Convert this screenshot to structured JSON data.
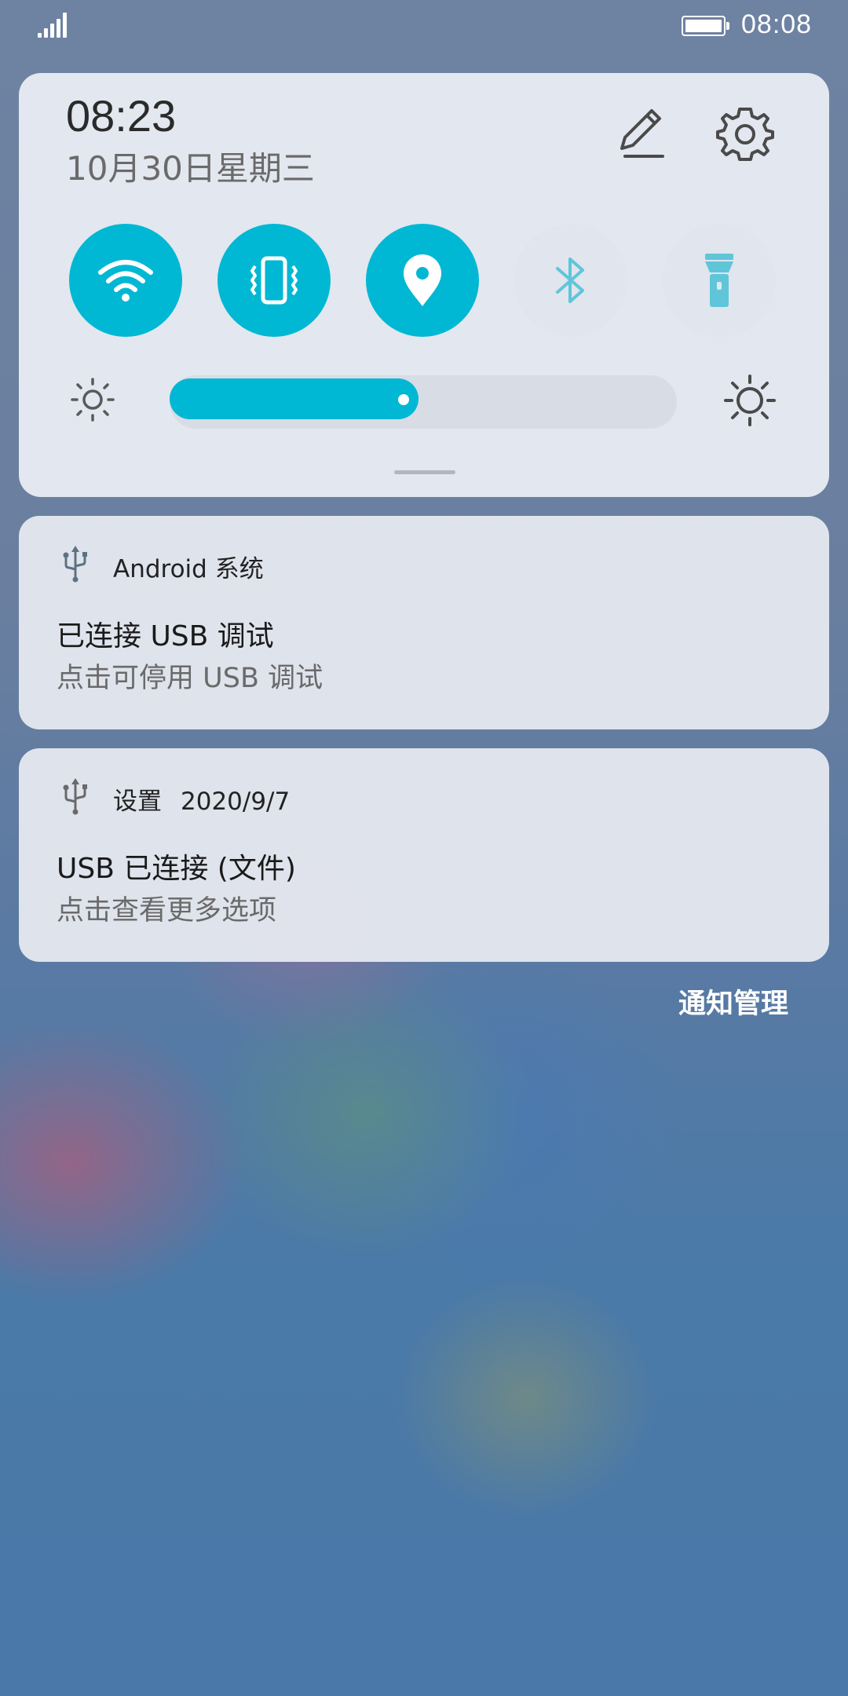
{
  "status_bar": {
    "time": "08:08",
    "signal_icon": "signal-strength-icon",
    "battery_icon": "battery-icon"
  },
  "quick_settings": {
    "time": "08:23",
    "date": "10月30日星期三",
    "edit_icon": "pencil-icon",
    "settings_icon": "gear-icon",
    "accent_color": "#00b8d4",
    "tiles": [
      {
        "icon": "wifi-icon",
        "state": "on"
      },
      {
        "icon": "vibrate-icon",
        "state": "on"
      },
      {
        "icon": "location-icon",
        "state": "on"
      },
      {
        "icon": "bluetooth-icon",
        "state": "off"
      },
      {
        "icon": "flashlight-icon",
        "state": "off"
      }
    ],
    "brightness": {
      "level": 0.49,
      "low_icon": "brightness-low-icon",
      "high_icon": "brightness-high-icon"
    }
  },
  "notifications": [
    {
      "icon": "usb-icon",
      "app": "Android 系统",
      "date": "",
      "title": "已连接 USB 调试",
      "body": "点击可停用 USB 调试"
    },
    {
      "icon": "usb-icon",
      "app": "设置",
      "date": "2020/9/7",
      "title": "USB 已连接 (文件)",
      "body": "点击查看更多选项"
    }
  ],
  "manage_label": "通知管理"
}
